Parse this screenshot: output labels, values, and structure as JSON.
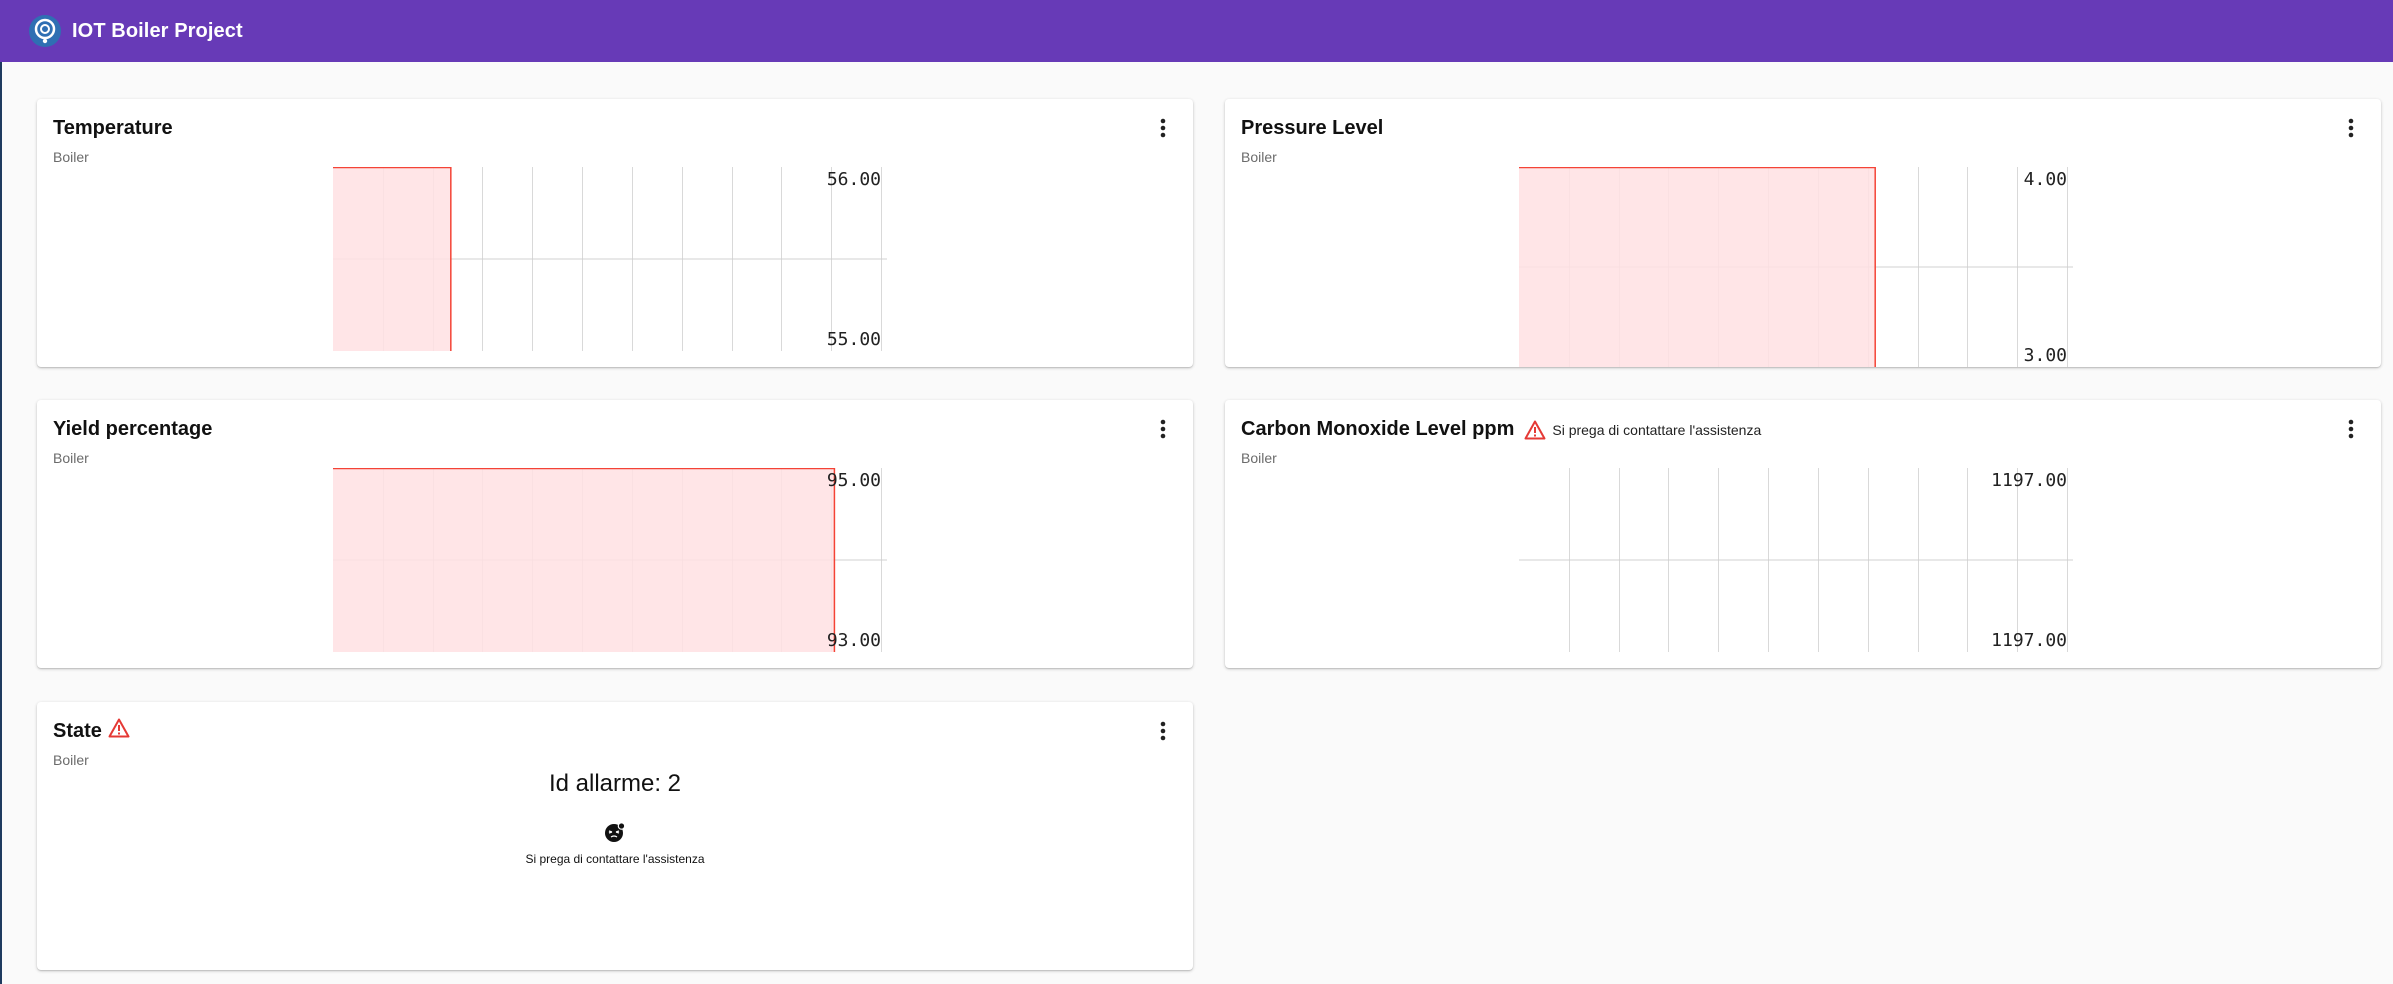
{
  "app": {
    "title": "IOT Boiler Project"
  },
  "colors": {
    "header": "#673ab7",
    "fill": "#ffe0e3",
    "line": "#f44336",
    "warning": "#e53935"
  },
  "cards": [
    {
      "title": "Temperature",
      "subtitle": "Boiler",
      "chart_data": {
        "type": "area",
        "y_top_label": "56.00",
        "y_bottom_label": "55.00",
        "ylim": [
          55.0,
          56.0
        ],
        "fill_fraction": 0.215,
        "fill_level": 56.0
      }
    },
    {
      "title": "Pressure Level",
      "subtitle": "Boiler",
      "chart_data": {
        "type": "area",
        "y_top_label": "4.00",
        "y_bottom_label": "3.00",
        "ylim": [
          3.0,
          4.0
        ],
        "fill_fraction": 0.65,
        "fill_level": 4.0
      }
    },
    {
      "title": "Yield percentage",
      "subtitle": "Boiler",
      "chart_data": {
        "type": "area",
        "y_top_label": "95.00",
        "y_bottom_label": "93.00",
        "ylim": [
          93.0,
          95.0
        ],
        "fill_fraction": 0.915,
        "fill_level": 95.0
      }
    },
    {
      "title": "Carbon Monoxide Level ppm",
      "subtitle": "Boiler",
      "alarm_text": "Si prega di contattare l'assistenza",
      "chart_data": {
        "type": "area",
        "y_top_label": "1197.00",
        "y_bottom_label": "1197.00",
        "ylim": [
          1197.0,
          1197.0
        ],
        "fill_fraction": 0,
        "fill_level": 1197.0
      }
    },
    {
      "title": "State",
      "subtitle": "Boiler",
      "alarm_id": "Id allarme: 2",
      "message": "Si prega di contattare l'assistenza",
      "icon": "boiler-alarm-icon"
    }
  ]
}
